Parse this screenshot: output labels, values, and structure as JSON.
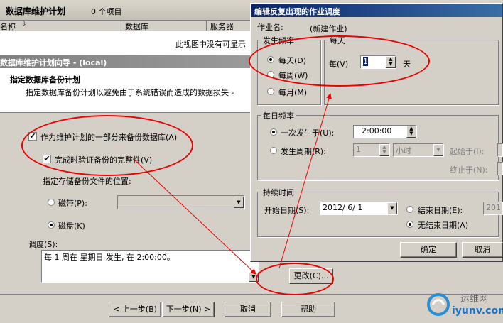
{
  "top_bar": {
    "title": "数据库维护计划",
    "count": "0 个项目"
  },
  "list": {
    "columns": [
      "名称",
      "数据库",
      "服务器"
    ],
    "empty_text": "此视图中没有可显示"
  },
  "wizard": {
    "title": "数据库维护计划向导 - (local)",
    "heading": "指定数据库备份计划",
    "description": "指定数据库备份计划以避免由于系统错误而造成的数据损失 -",
    "backup_checkbox": "作为维护计划的一部分来备份数据库(A)",
    "verify_checkbox": "完成时验证备份的完整性(V)",
    "location_label": "指定存储备份文件的位置:",
    "tape_label": "磁带(P):",
    "disk_label": "磁盘(K)",
    "schedule_label": "调度(S):",
    "schedule_text": "每 1 周在 星期日 发生, 在 2:00:00。",
    "change_button": "更改(C)...",
    "back_button": "< 上一步(B)",
    "next_button": "下一步(N) >",
    "cancel_button": "取消",
    "help_button": "帮助"
  },
  "dialog": {
    "title": "编辑反复出现的作业调度",
    "job_name_label": "作业名:",
    "job_name_value": "(新建作业)",
    "freq_group": "发生频率",
    "daily": "每天(D)",
    "weekly": "每周(W)",
    "monthly": "每月(M)",
    "daily_group": "每天",
    "every_label": "每(V)",
    "every_value": "1",
    "days_unit": "天",
    "daily_freq_group": "每日频率",
    "once_label": "一次发生于(U):",
    "once_time": "2:00:00",
    "recur_label": "发生周期(R):",
    "recur_value": "1",
    "recur_unit": "小时",
    "start_label": "起始于(I):",
    "end_label": "终止于(N):",
    "duration_group": "持续时间",
    "start_date_label": "开始日期(S):",
    "start_date": "2012/ 6/ 1",
    "end_date_label": "结束日期(E):",
    "end_date_value": "201",
    "no_end_label": "无结束日期(A)",
    "ok_button": "确定",
    "cancel_button": "取消"
  },
  "watermark": {
    "line1": "运维网",
    "line2": "iyunv.com"
  },
  "colors": {
    "title_bar": "#0a246a",
    "annotation": "#ee0000"
  }
}
